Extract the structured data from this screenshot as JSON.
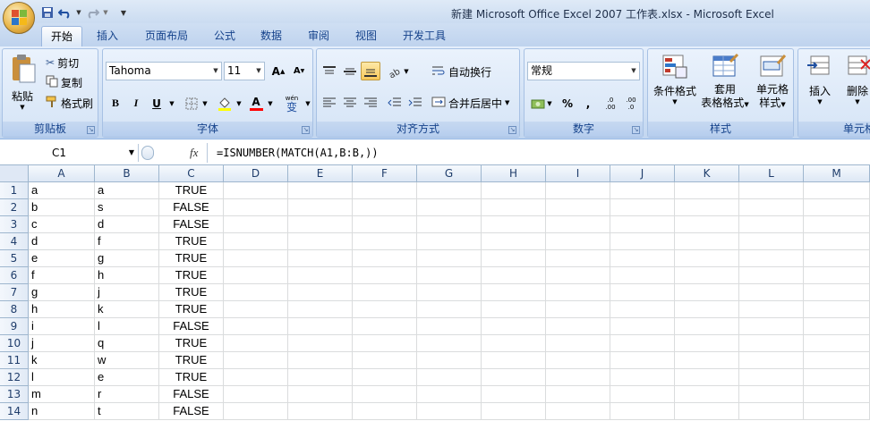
{
  "window": {
    "title": "新建 Microsoft Office Excel 2007 工作表.xlsx - Microsoft Excel"
  },
  "tabs": [
    "开始",
    "插入",
    "页面布局",
    "公式",
    "数据",
    "审阅",
    "视图",
    "开发工具"
  ],
  "ribbon": {
    "clipboard": {
      "paste": "粘贴",
      "cut": "剪切",
      "copy": "复制",
      "format_painter": "格式刷",
      "label": "剪贴板"
    },
    "font": {
      "name": "Tahoma",
      "size": "11",
      "grow": "A",
      "shrink": "A",
      "bold": "B",
      "italic": "I",
      "underline": "U",
      "color_a": "A",
      "phonetic": "wén",
      "phonetic2": "变",
      "label": "字体"
    },
    "alignment": {
      "wrap": "自动换行",
      "merge": "合并后居中",
      "label": "对齐方式"
    },
    "number": {
      "format": "常规",
      "percent": "%",
      "comma": ",",
      "inc_decimal": ".0\n.00",
      "dec_decimal": ".00\n.0",
      "label": "数字"
    },
    "styles": {
      "conditional": "条件格式",
      "table1": "套用",
      "table2": "表格格式",
      "cell1": "单元格",
      "cell2": "样式",
      "label": "样式"
    },
    "cells": {
      "insert": "插入",
      "delete": "删除",
      "label": "单元格"
    }
  },
  "formula_bar": {
    "name_box": "C1",
    "fx": "fx",
    "formula": "=ISNUMBER(MATCH(A1,B:B,))"
  },
  "grid": {
    "columns": [
      "A",
      "B",
      "C",
      "D",
      "E",
      "F",
      "G",
      "H",
      "I",
      "J",
      "K",
      "L",
      "M"
    ],
    "rows": [
      {
        "n": "1",
        "a": "a",
        "b": "a",
        "c": "TRUE"
      },
      {
        "n": "2",
        "a": "b",
        "b": "s",
        "c": "FALSE"
      },
      {
        "n": "3",
        "a": "c",
        "b": "d",
        "c": "FALSE"
      },
      {
        "n": "4",
        "a": "d",
        "b": "f",
        "c": "TRUE"
      },
      {
        "n": "5",
        "a": "e",
        "b": "g",
        "c": "TRUE"
      },
      {
        "n": "6",
        "a": "f",
        "b": "h",
        "c": "TRUE"
      },
      {
        "n": "7",
        "a": "g",
        "b": "j",
        "c": "TRUE"
      },
      {
        "n": "8",
        "a": "h",
        "b": "k",
        "c": "TRUE"
      },
      {
        "n": "9",
        "a": "i",
        "b": "l",
        "c": "FALSE"
      },
      {
        "n": "10",
        "a": "j",
        "b": "q",
        "c": "TRUE"
      },
      {
        "n": "11",
        "a": "k",
        "b": "w",
        "c": "TRUE"
      },
      {
        "n": "12",
        "a": "l",
        "b": "e",
        "c": "TRUE"
      },
      {
        "n": "13",
        "a": "m",
        "b": "r",
        "c": "FALSE"
      },
      {
        "n": "14",
        "a": "n",
        "b": "t",
        "c": "FALSE"
      }
    ]
  }
}
